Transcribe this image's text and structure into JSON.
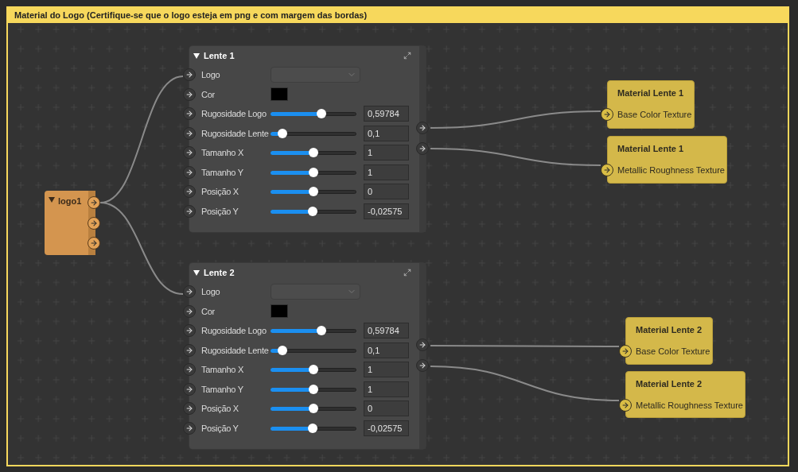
{
  "frame": {
    "title": "Material do Logo (Certifique-se que o logo esteja em png e com margem das bordas)"
  },
  "source_node": {
    "title": "logo1",
    "expanded": true
  },
  "lens_nodes": [
    {
      "title": "Lente 1",
      "expanded": true,
      "properties": [
        {
          "kind": "dropdown",
          "label": "Logo"
        },
        {
          "kind": "color",
          "label": "Cor",
          "color": "#000000"
        },
        {
          "kind": "slider",
          "label": "Rugosidade Logo",
          "level": 0.59,
          "value": "0,59784"
        },
        {
          "kind": "slider",
          "label": "Rugosidade Lente",
          "level": 0.14,
          "value": "0,1"
        },
        {
          "kind": "slider",
          "label": "Tamanho X",
          "level": 0.5,
          "value": "1"
        },
        {
          "kind": "slider",
          "label": "Tamanho Y",
          "level": 0.5,
          "value": "1"
        },
        {
          "kind": "slider",
          "label": "Posição X",
          "level": 0.5,
          "value": "0"
        },
        {
          "kind": "slider",
          "label": "Posição Y",
          "level": 0.49,
          "value": "-0,02575"
        }
      ]
    },
    {
      "title": "Lente 2",
      "expanded": true,
      "properties": [
        {
          "kind": "dropdown",
          "label": "Logo"
        },
        {
          "kind": "color",
          "label": "Cor",
          "color": "#000000"
        },
        {
          "kind": "slider",
          "label": "Rugosidade Logo",
          "level": 0.59,
          "value": "0,59784"
        },
        {
          "kind": "slider",
          "label": "Rugosidade Lente",
          "level": 0.14,
          "value": "0,1"
        },
        {
          "kind": "slider",
          "label": "Tamanho X",
          "level": 0.5,
          "value": "1"
        },
        {
          "kind": "slider",
          "label": "Tamanho Y",
          "level": 0.5,
          "value": "1"
        },
        {
          "kind": "slider",
          "label": "Posição X",
          "level": 0.5,
          "value": "0"
        },
        {
          "kind": "slider",
          "label": "Posição Y",
          "level": 0.49,
          "value": "-0,02575"
        }
      ]
    }
  ],
  "material_nodes": [
    {
      "title": "Material Lente 1",
      "input": "Base Color Texture"
    },
    {
      "title": "Material Lente 1",
      "input": "Metallic Roughness Texture"
    },
    {
      "title": "Material Lente 2",
      "input": "Base Color Texture"
    },
    {
      "title": "Material Lente 2",
      "input": "Metallic Roughness Texture"
    }
  ]
}
